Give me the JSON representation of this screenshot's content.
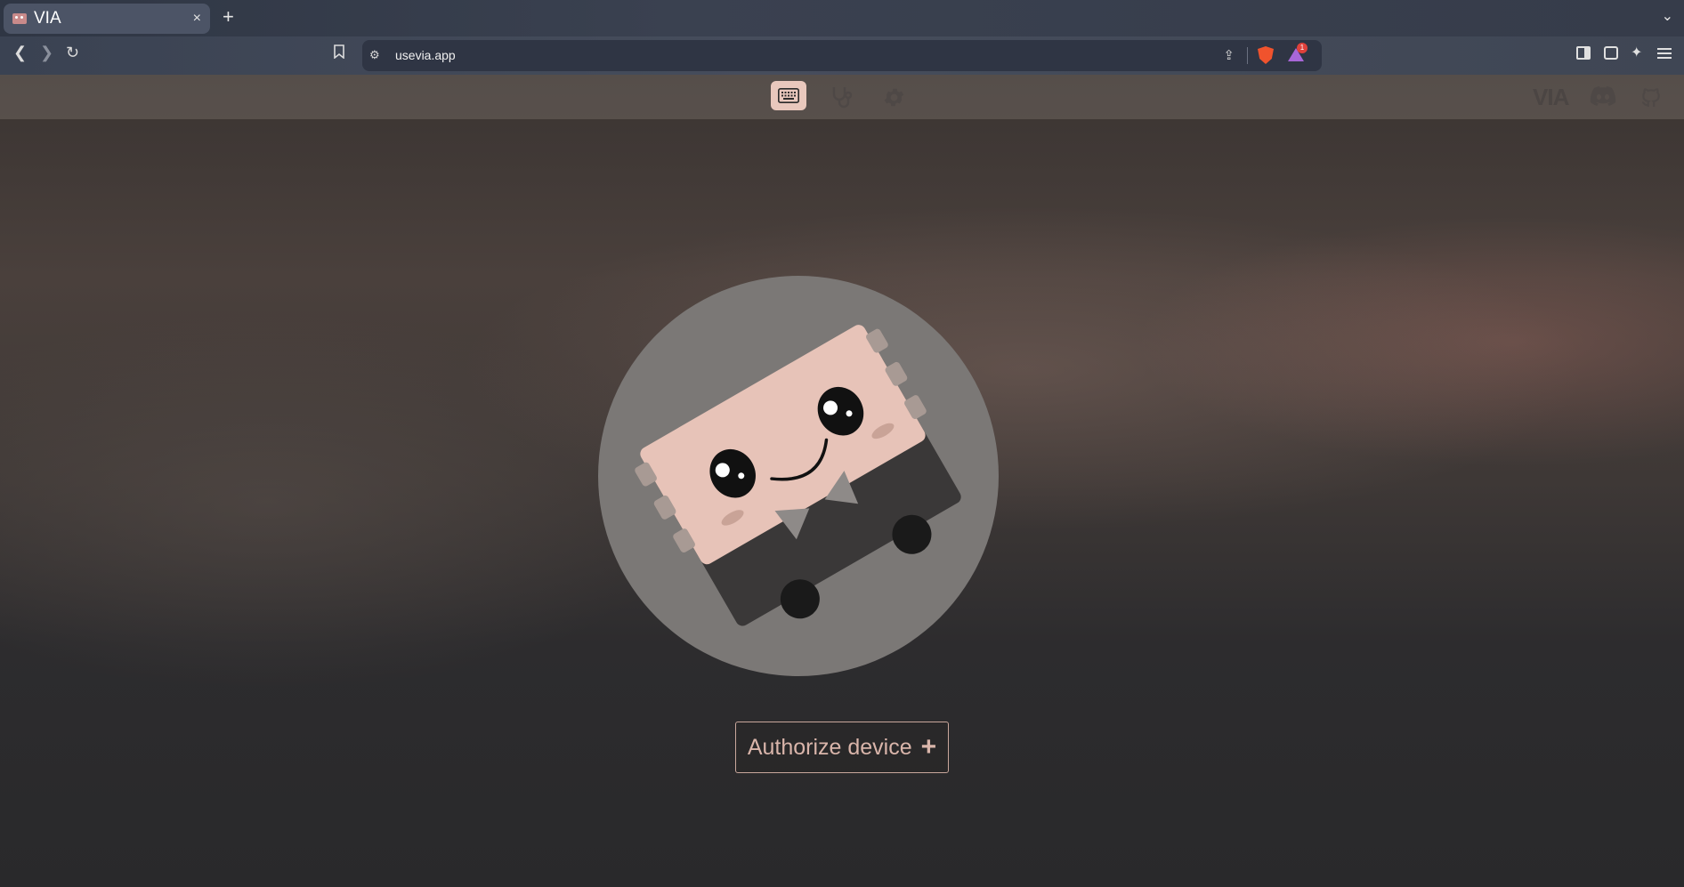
{
  "browser": {
    "tab_title": "VIA",
    "tab_close": "×",
    "new_tab": "+",
    "tab_list": "⌄",
    "back": "❮",
    "forward": "❯",
    "reload": "↻",
    "bookmark": "🔖",
    "url": "usevia.app",
    "rewards_badge": "1"
  },
  "app": {
    "brand": "VIA",
    "nav": [
      "keyboard-icon",
      "stethoscope-icon",
      "gear-icon"
    ],
    "external": [
      "discord-icon",
      "github-icon"
    ]
  },
  "main": {
    "authorize_label": "Authorize device",
    "authorize_icon": "+"
  },
  "colors": {
    "accent": "#e9c8bd",
    "button_text": "#d9b5aa"
  }
}
